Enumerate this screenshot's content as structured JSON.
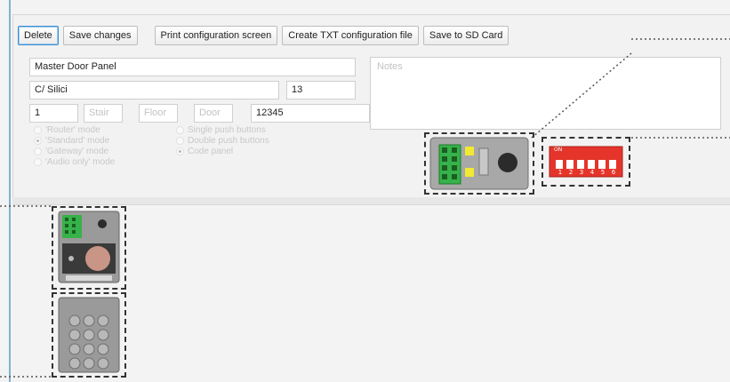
{
  "toolbar": {
    "delete_label": "Delete",
    "save_label": "Save changes",
    "print_label": "Print configuration screen",
    "txt_label": "Create TXT configuration file",
    "sd_label": "Save to SD Card"
  },
  "form": {
    "name": "Master Door Panel",
    "street": "C/ Silici",
    "number": "13",
    "block": "1",
    "stair_placeholder": "Stair",
    "floor_placeholder": "Floor",
    "door_placeholder": "Door",
    "code": "12345",
    "notes_placeholder": "Notes"
  },
  "modes": [
    {
      "label": "'Router' mode",
      "selected": false
    },
    {
      "label": "'Standard' mode",
      "selected": true
    },
    {
      "label": "'Gateway' mode",
      "selected": false
    },
    {
      "label": "'Audio only' mode",
      "selected": false
    }
  ],
  "buttons_type": [
    {
      "label": "Single push buttons",
      "selected": false
    },
    {
      "label": "Double push buttons",
      "selected": false
    },
    {
      "label": "Code panel",
      "selected": true
    }
  ],
  "dip_switch": {
    "header": "ON",
    "numbers": [
      "1",
      "2",
      "3",
      "4",
      "5",
      "6"
    ],
    "color": "#e5352b"
  },
  "colors": {
    "accent": "#3d8ed0",
    "module_gray": "#9a9a9a",
    "terminal_green": "#36b24a",
    "speaker_tan": "#c99587"
  }
}
